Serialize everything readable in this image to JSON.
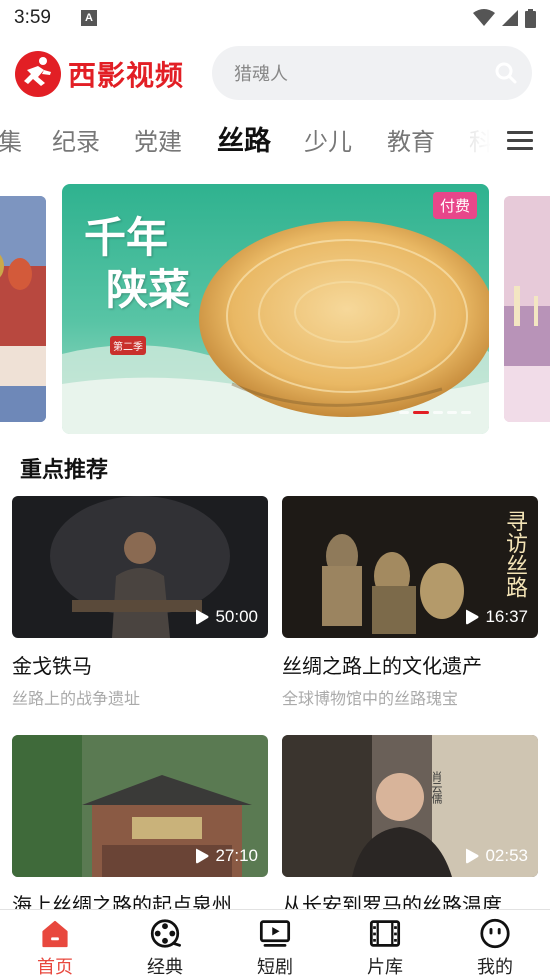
{
  "status_bar": {
    "time": "3:59",
    "notif_letter": "A"
  },
  "header": {
    "logo_text": "西影视频",
    "search_placeholder": "猎魂人"
  },
  "categories": [
    {
      "label": "集"
    },
    {
      "label": "纪录"
    },
    {
      "label": "党建"
    },
    {
      "label": "丝路",
      "active": true
    },
    {
      "label": "少儿"
    },
    {
      "label": "教育"
    },
    {
      "label": "科"
    }
  ],
  "carousel": {
    "pay_badge": "付费",
    "banner_title_line1": "千年",
    "banner_title_line2": "陕菜",
    "banner_seal": "第二季",
    "active_dot": 1,
    "dot_count": 5
  },
  "section": {
    "title": "重点推荐"
  },
  "videos": [
    {
      "title": "金戈铁马",
      "subtitle": "丝路上的战争遗址",
      "duration": "50:00"
    },
    {
      "title": "丝绸之路上的文化遗产",
      "subtitle": "全球博物馆中的丝路瑰宝",
      "duration": "16:37",
      "overlay_text": "寻访丝路"
    },
    {
      "title": "海上丝绸之路的起点泉州",
      "subtitle": "",
      "duration": "27:10"
    },
    {
      "title": "从长安到罗马的丝路温度",
      "subtitle": "",
      "duration": "02:53",
      "overlay_text": "肖云儒"
    }
  ],
  "bottom_nav": [
    {
      "label": "首页",
      "icon": "home-icon",
      "active": true
    },
    {
      "label": "经典",
      "icon": "film-reel-icon"
    },
    {
      "label": "短剧",
      "icon": "play-screen-icon"
    },
    {
      "label": "片库",
      "icon": "film-strip-icon"
    },
    {
      "label": "我的",
      "icon": "profile-face-icon"
    }
  ],
  "colors": {
    "brand_red": "#e21f25",
    "active_nav": "#e8483e",
    "pay_badge": "#e8468a"
  }
}
